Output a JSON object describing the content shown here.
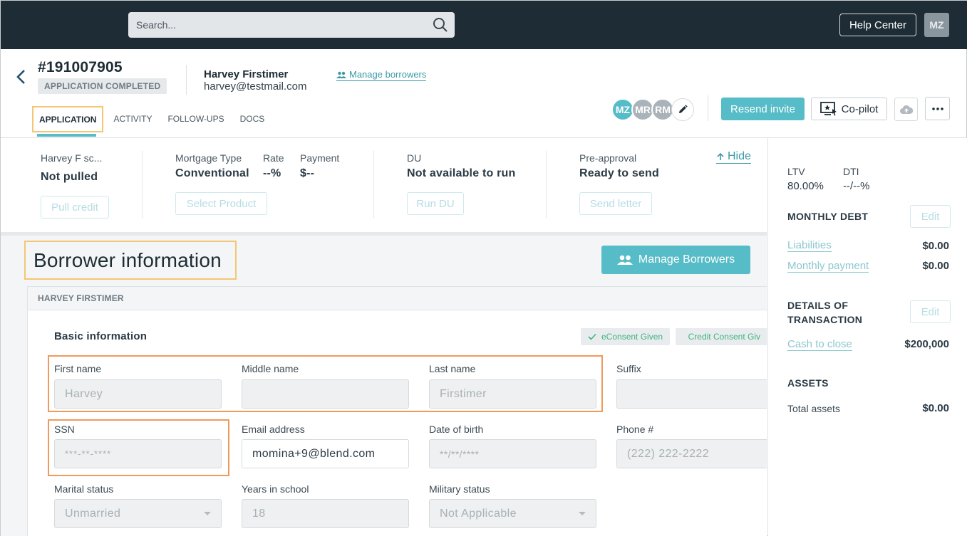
{
  "topbar": {
    "search_placeholder": "Search...",
    "help_label": "Help Center",
    "user_initials": "MZ"
  },
  "header": {
    "loan_number": "#191007905",
    "status": "APPLICATION COMPLETED",
    "borrower_name": "Harvey Firstimer",
    "borrower_email": "harvey@testmail.com",
    "manage_link": "Manage borrowers",
    "tabs": [
      {
        "label": "APPLICATION",
        "active": true
      },
      {
        "label": "ACTIVITY",
        "active": false
      },
      {
        "label": "FOLLOW-UPS",
        "active": false
      },
      {
        "label": "DOCS",
        "active": false
      }
    ],
    "avatars": [
      {
        "initials": "MZ",
        "color": "#56bcc7"
      },
      {
        "initials": "MR",
        "color": "#a9b3b9"
      },
      {
        "initials": "RM",
        "color": "#a9b3b9"
      }
    ],
    "resend_label": "Resend invite",
    "copilot_label": "Co-pilot"
  },
  "summary": {
    "credit": {
      "label": "Harvey F sc...",
      "value": "Not pulled",
      "button": "Pull credit"
    },
    "mortgage": {
      "label": "Mortgage Type",
      "value": "Conventional",
      "button": "Select Product"
    },
    "rate": {
      "label": "Rate",
      "value": "--%"
    },
    "payment": {
      "label": "Payment",
      "value": "$--"
    },
    "du": {
      "label": "DU",
      "value": "Not available to run",
      "button": "Run DU"
    },
    "preapproval": {
      "label": "Pre-approval",
      "value": "Ready to send",
      "button": "Send letter"
    },
    "hide_label": "Hide"
  },
  "main": {
    "section_title": "Borrower information",
    "manage_button": "Manage Borrowers",
    "card_title": "HARVEY FIRSTIMER",
    "basic_title": "Basic information",
    "consents": [
      "eConsent Given",
      "Credit Consent Giv"
    ],
    "fields": {
      "first_name": {
        "label": "First name",
        "value": "Harvey"
      },
      "middle_name": {
        "label": "Middle name",
        "value": ""
      },
      "last_name": {
        "label": "Last name",
        "value": "Firstimer"
      },
      "suffix": {
        "label": "Suffix",
        "value": ""
      },
      "ssn": {
        "label": "SSN",
        "value": "***-**-****"
      },
      "email": {
        "label": "Email address",
        "value": "momina+9@blend.com"
      },
      "dob": {
        "label": "Date of birth",
        "value": "**/**/****"
      },
      "phone": {
        "label": "Phone #",
        "value": "(222) 222-2222"
      },
      "marital": {
        "label": "Marital status",
        "value": "Unmarried"
      },
      "years_school": {
        "label": "Years in school",
        "value": "18"
      },
      "military": {
        "label": "Military status",
        "value": "Not Applicable"
      }
    }
  },
  "right_panel": {
    "ltv_label": "LTV",
    "ltv_value": "80.00%",
    "dti_label": "DTI",
    "dti_value": "--/--%",
    "monthly_debt_title": "MONTHLY DEBT",
    "edit_label": "Edit",
    "liabilities_label": "Liabilities",
    "liabilities_value": "$0.00",
    "monthly_payment_label": "Monthly payment",
    "monthly_payment_value": "$0.00",
    "details_title": "DETAILS OF TRANSACTION",
    "cash_to_close_label": "Cash to close",
    "cash_to_close_value": "$200,000",
    "assets_title": "ASSETS",
    "total_assets_label": "Total assets",
    "total_assets_value": "$0.00"
  }
}
